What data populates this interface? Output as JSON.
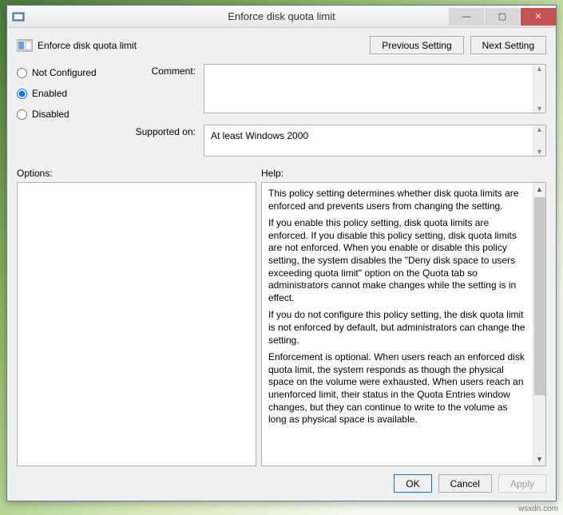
{
  "window": {
    "title": "Enforce disk quota limit"
  },
  "header": {
    "title": "Enforce disk quota limit",
    "prev": "Previous Setting",
    "next": "Next Setting"
  },
  "radios": {
    "not_configured": "Not Configured",
    "enabled": "Enabled",
    "disabled": "Disabled",
    "selected": "enabled"
  },
  "fields": {
    "comment_label": "Comment:",
    "comment_value": "",
    "supported_label": "Supported on:",
    "supported_value": "At least Windows 2000"
  },
  "sections": {
    "options": "Options:",
    "help": "Help:"
  },
  "help": {
    "p1": "This policy setting determines whether disk quota limits are enforced and prevents users from changing the setting.",
    "p2": "If you enable this policy setting, disk quota limits are enforced. If you disable this policy setting, disk quota limits are not enforced. When you enable or disable this policy setting, the system disables the \"Deny disk space to users exceeding quota limit\" option on the Quota tab so administrators cannot make changes while the setting is in effect.",
    "p3": "If you do not configure this policy setting, the disk quota limit is not enforced by default, but administrators can change the setting.",
    "p4": "Enforcement is optional. When users reach an enforced disk quota limit, the system responds as though the physical space on the volume were exhausted. When users reach an unenforced limit, their status in the Quota Entries window changes, but they can continue to write to the volume as long as physical space is available."
  },
  "footer": {
    "ok": "OK",
    "cancel": "Cancel",
    "apply": "Apply"
  },
  "watermark": "wsxdn.com"
}
